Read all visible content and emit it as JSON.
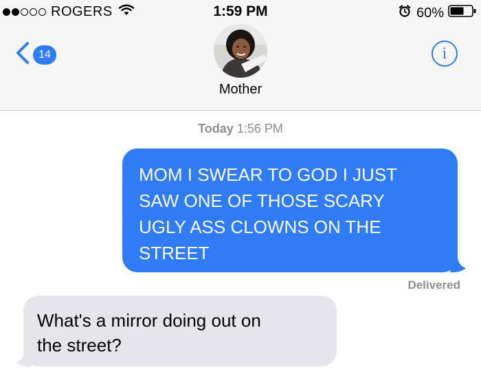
{
  "status_bar": {
    "carrier": "ROGERS",
    "signal_bars_filled": 2,
    "signal_bars_total": 5,
    "time": "1:59 PM",
    "battery_percent": "60%",
    "icons": [
      "wifi-icon",
      "alarm-icon",
      "battery-icon"
    ]
  },
  "nav": {
    "back_icon": "chevron-left-icon",
    "unread_badge": "14",
    "contact_name": "Mother",
    "info_icon": "info-icon",
    "info_glyph": "i"
  },
  "thread": {
    "timestamp_day": "Today",
    "timestamp_time": "1:56 PM",
    "messages": [
      {
        "direction": "sent",
        "lines": [
          "MOM I SWEAR TO GOD I JUST",
          "SAW ONE OF THOSE SCARY",
          "UGLY ASS CLOWNS ON THE",
          "STREET"
        ]
      },
      {
        "direction": "received",
        "lines": [
          "What's a mirror doing out on",
          "the street?"
        ]
      }
    ],
    "delivered_label": "Delivered"
  },
  "colors": {
    "sent_bubble": "#2f7cf6",
    "received_bubble": "#e5e5ea",
    "accent": "#2f7cf6",
    "meta_text": "#8e8e93",
    "header_bg": "#f6f6f7"
  }
}
